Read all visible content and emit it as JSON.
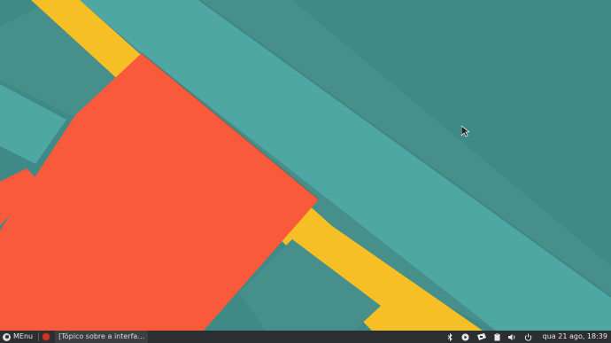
{
  "desktop": {
    "colors": {
      "teal_dark": "#3f8a86",
      "teal_mid": "#468f8b",
      "teal_light": "#4fa7a3",
      "yellow": "#f6bf26",
      "orange": "#fa5a3c"
    }
  },
  "taskbar": {
    "menu_label": "MEnu",
    "launcher_icon": "app-launcher-icon",
    "task_title": "[Tópico sobre a interfa…",
    "tray_icons": [
      "bluetooth-icon",
      "media-player-icon",
      "network-icon",
      "clipboard-icon",
      "volume-icon",
      "power-icon"
    ],
    "clock": "qua 21 ago, 18:39"
  }
}
